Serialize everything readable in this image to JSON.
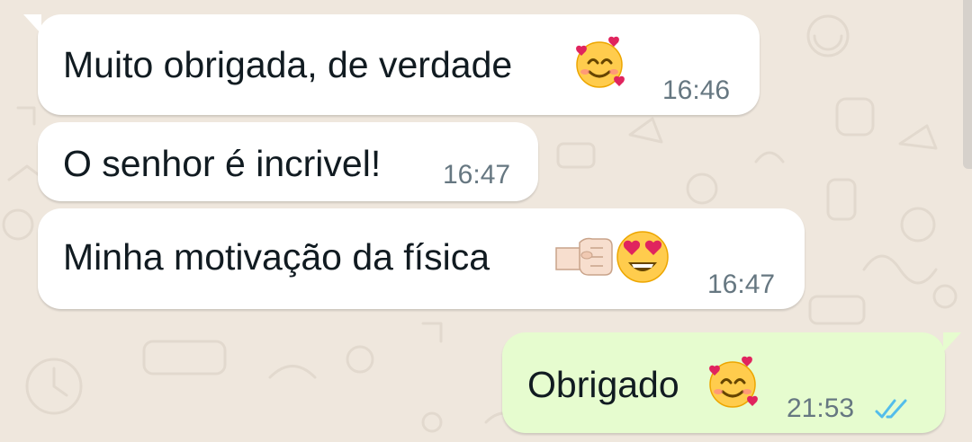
{
  "chat": {
    "messages": [
      {
        "direction": "incoming",
        "text": "Muito obrigada, de verdade",
        "emojis": [
          "smiling-face-with-hearts"
        ],
        "time": "16:46"
      },
      {
        "direction": "incoming",
        "text": "O senhor é incrivel!",
        "emojis": [],
        "time": "16:47"
      },
      {
        "direction": "incoming",
        "text": "Minha motivação da física",
        "emojis": [
          "left-facing-fist",
          "smiling-face-with-heart-eyes"
        ],
        "time": "16:47"
      },
      {
        "direction": "outgoing",
        "text": "Obrigado",
        "emojis": [
          "smiling-face-with-hearts"
        ],
        "time": "21:53",
        "status_icon": "double-check-read-icon"
      }
    ]
  },
  "colors": {
    "wallpaper": "#efe7dd",
    "incoming_bubble": "#ffffff",
    "outgoing_bubble": "#e6fccf",
    "text": "#111b21",
    "timestamp": "#667781",
    "read_check": "#53bdeb"
  }
}
